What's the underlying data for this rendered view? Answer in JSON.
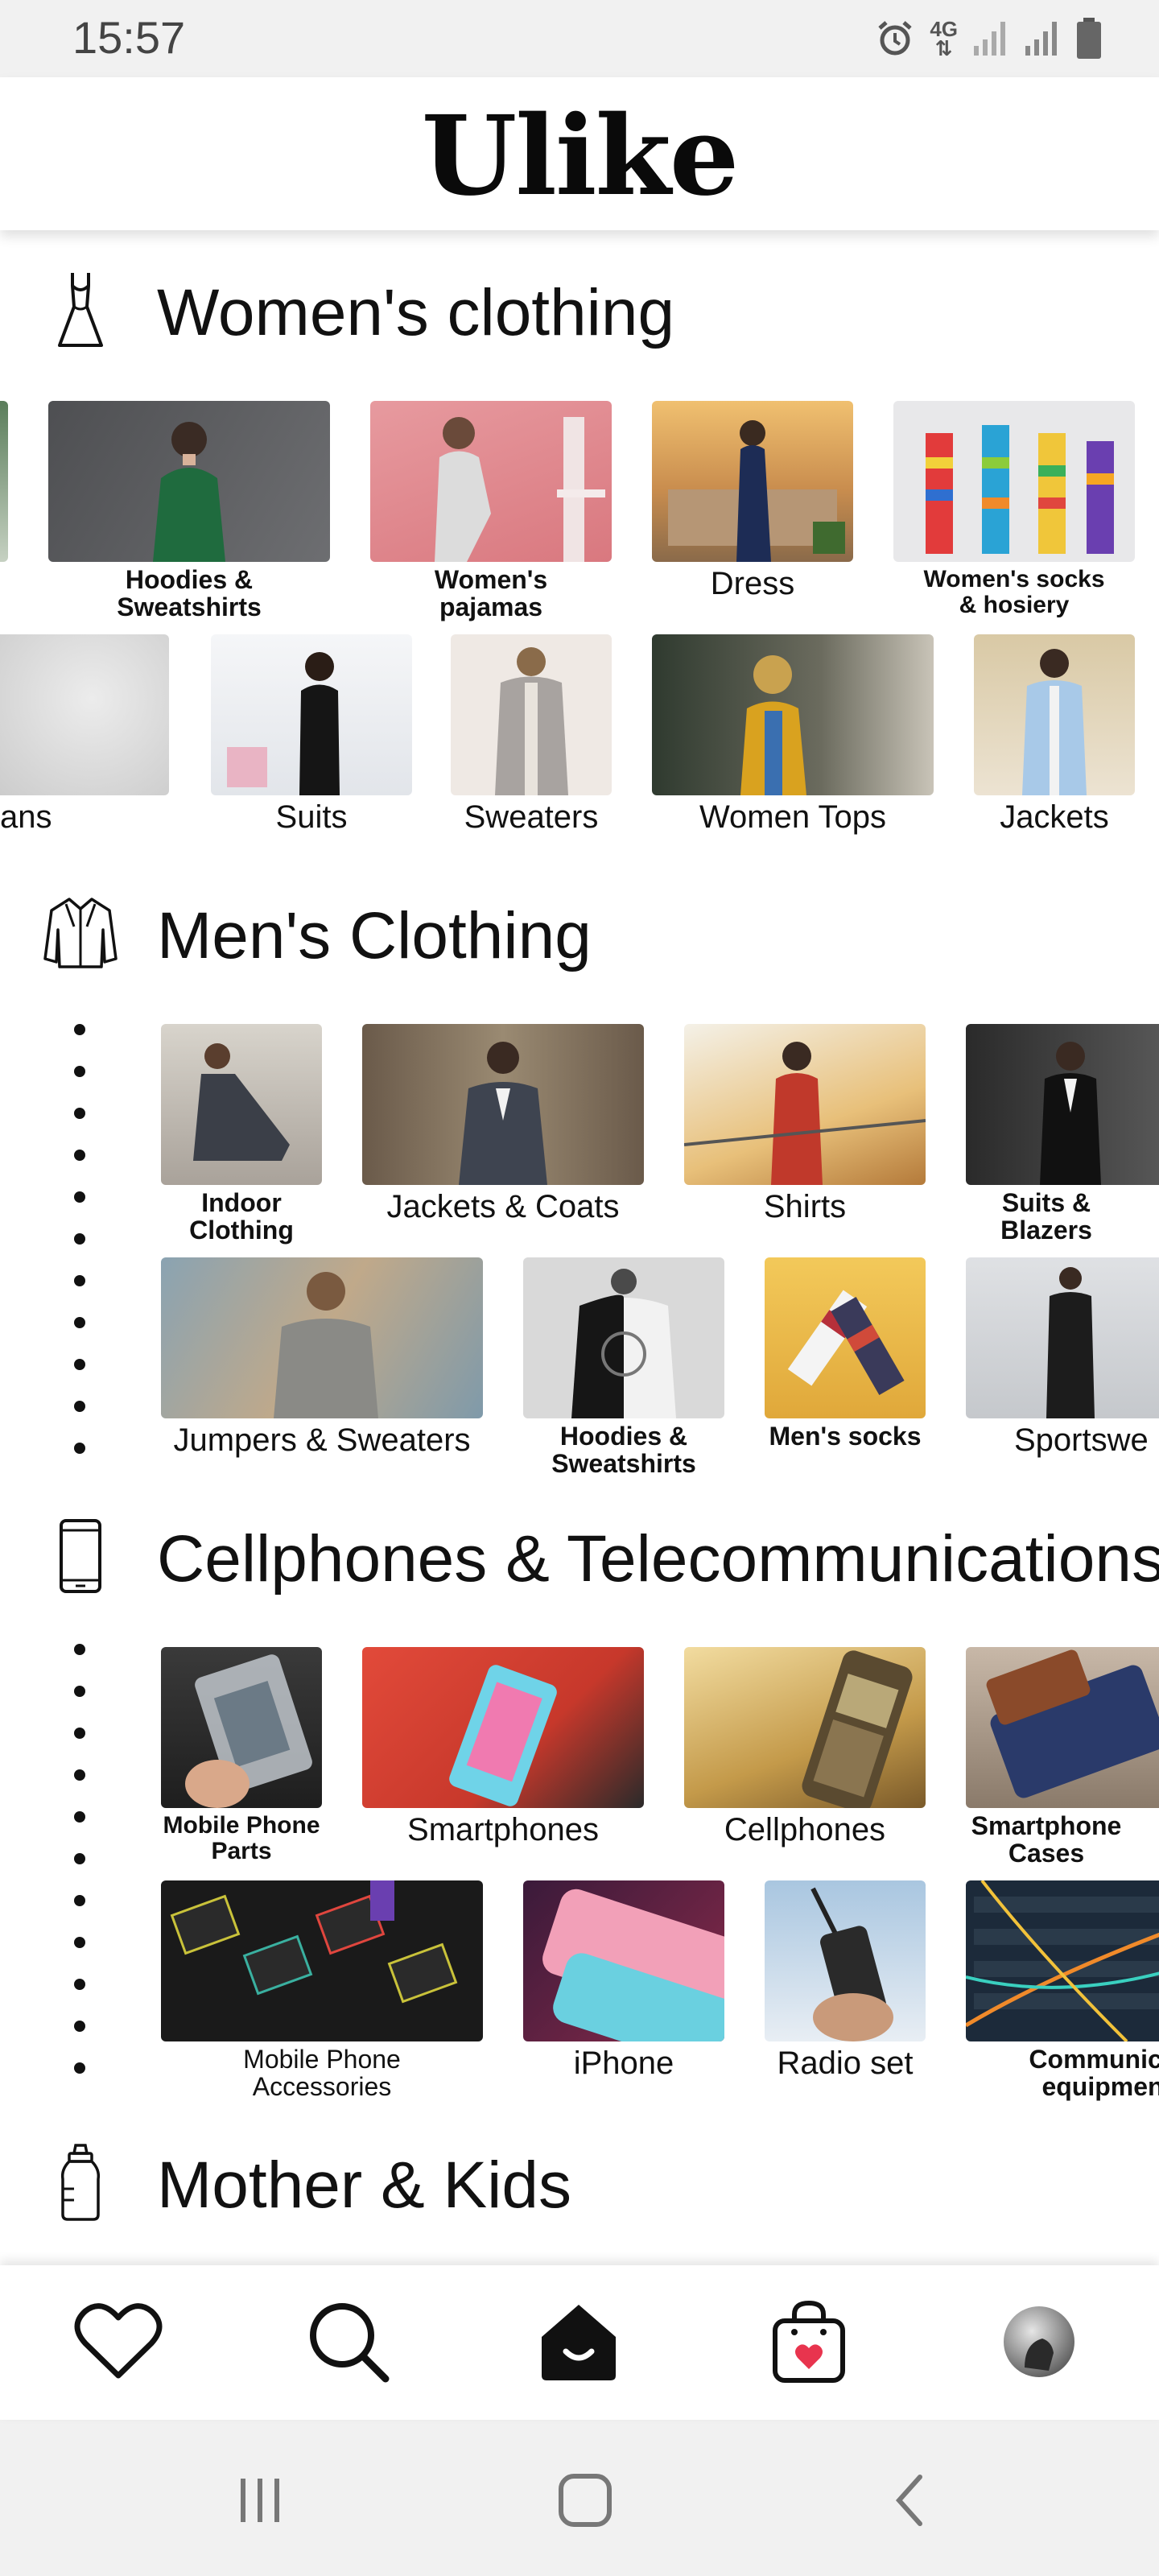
{
  "status": {
    "time": "15:57",
    "network": "4G"
  },
  "app": {
    "title": "Ulike"
  },
  "sections": {
    "women": {
      "title": "Women's clothing",
      "icon": "dress-icon",
      "row1": [
        "Hoodies &\nSweatshirts",
        "Women's\npajamas",
        "Dress",
        "Women's socks\n& hosiery"
      ],
      "row2": [
        "ans",
        "Suits",
        "Sweaters",
        "Women Tops",
        "Jackets"
      ]
    },
    "men": {
      "title": "Men's Clothing",
      "icon": "jacket-icon",
      "row1": [
        "Indoor\nClothing",
        "Jackets & Coats",
        "Shirts",
        "Suits &\nBlazers"
      ],
      "row2": [
        "Jumpers & Sweaters",
        "Hoodies &\nSweatshirts",
        "Men's socks",
        "Sportswe"
      ]
    },
    "phones": {
      "title": "Cellphones & Telecommunications",
      "icon": "smartphone-icon",
      "row1": [
        "Mobile Phone\nParts",
        "Smartphones",
        "Cellphones",
        "Smartphone\nCases"
      ],
      "row2": [
        "Mobile Phone\nAccessories",
        "iPhone",
        "Radio set",
        "Communica\nequipmen"
      ]
    },
    "kids": {
      "title": "Mother & Kids",
      "icon": "baby-bottle-icon"
    }
  },
  "tabbar": {
    "items": [
      {
        "name": "wishlist",
        "icon": "heart-icon"
      },
      {
        "name": "search",
        "icon": "search-icon"
      },
      {
        "name": "home",
        "icon": "home-icon"
      },
      {
        "name": "cart",
        "icon": "shopping-bag-icon"
      },
      {
        "name": "profile",
        "icon": "avatar-icon"
      }
    ]
  },
  "colors": {
    "accent": "#111111",
    "cart_heart": "#e8344e",
    "status_bar": "#f1f1f1"
  }
}
